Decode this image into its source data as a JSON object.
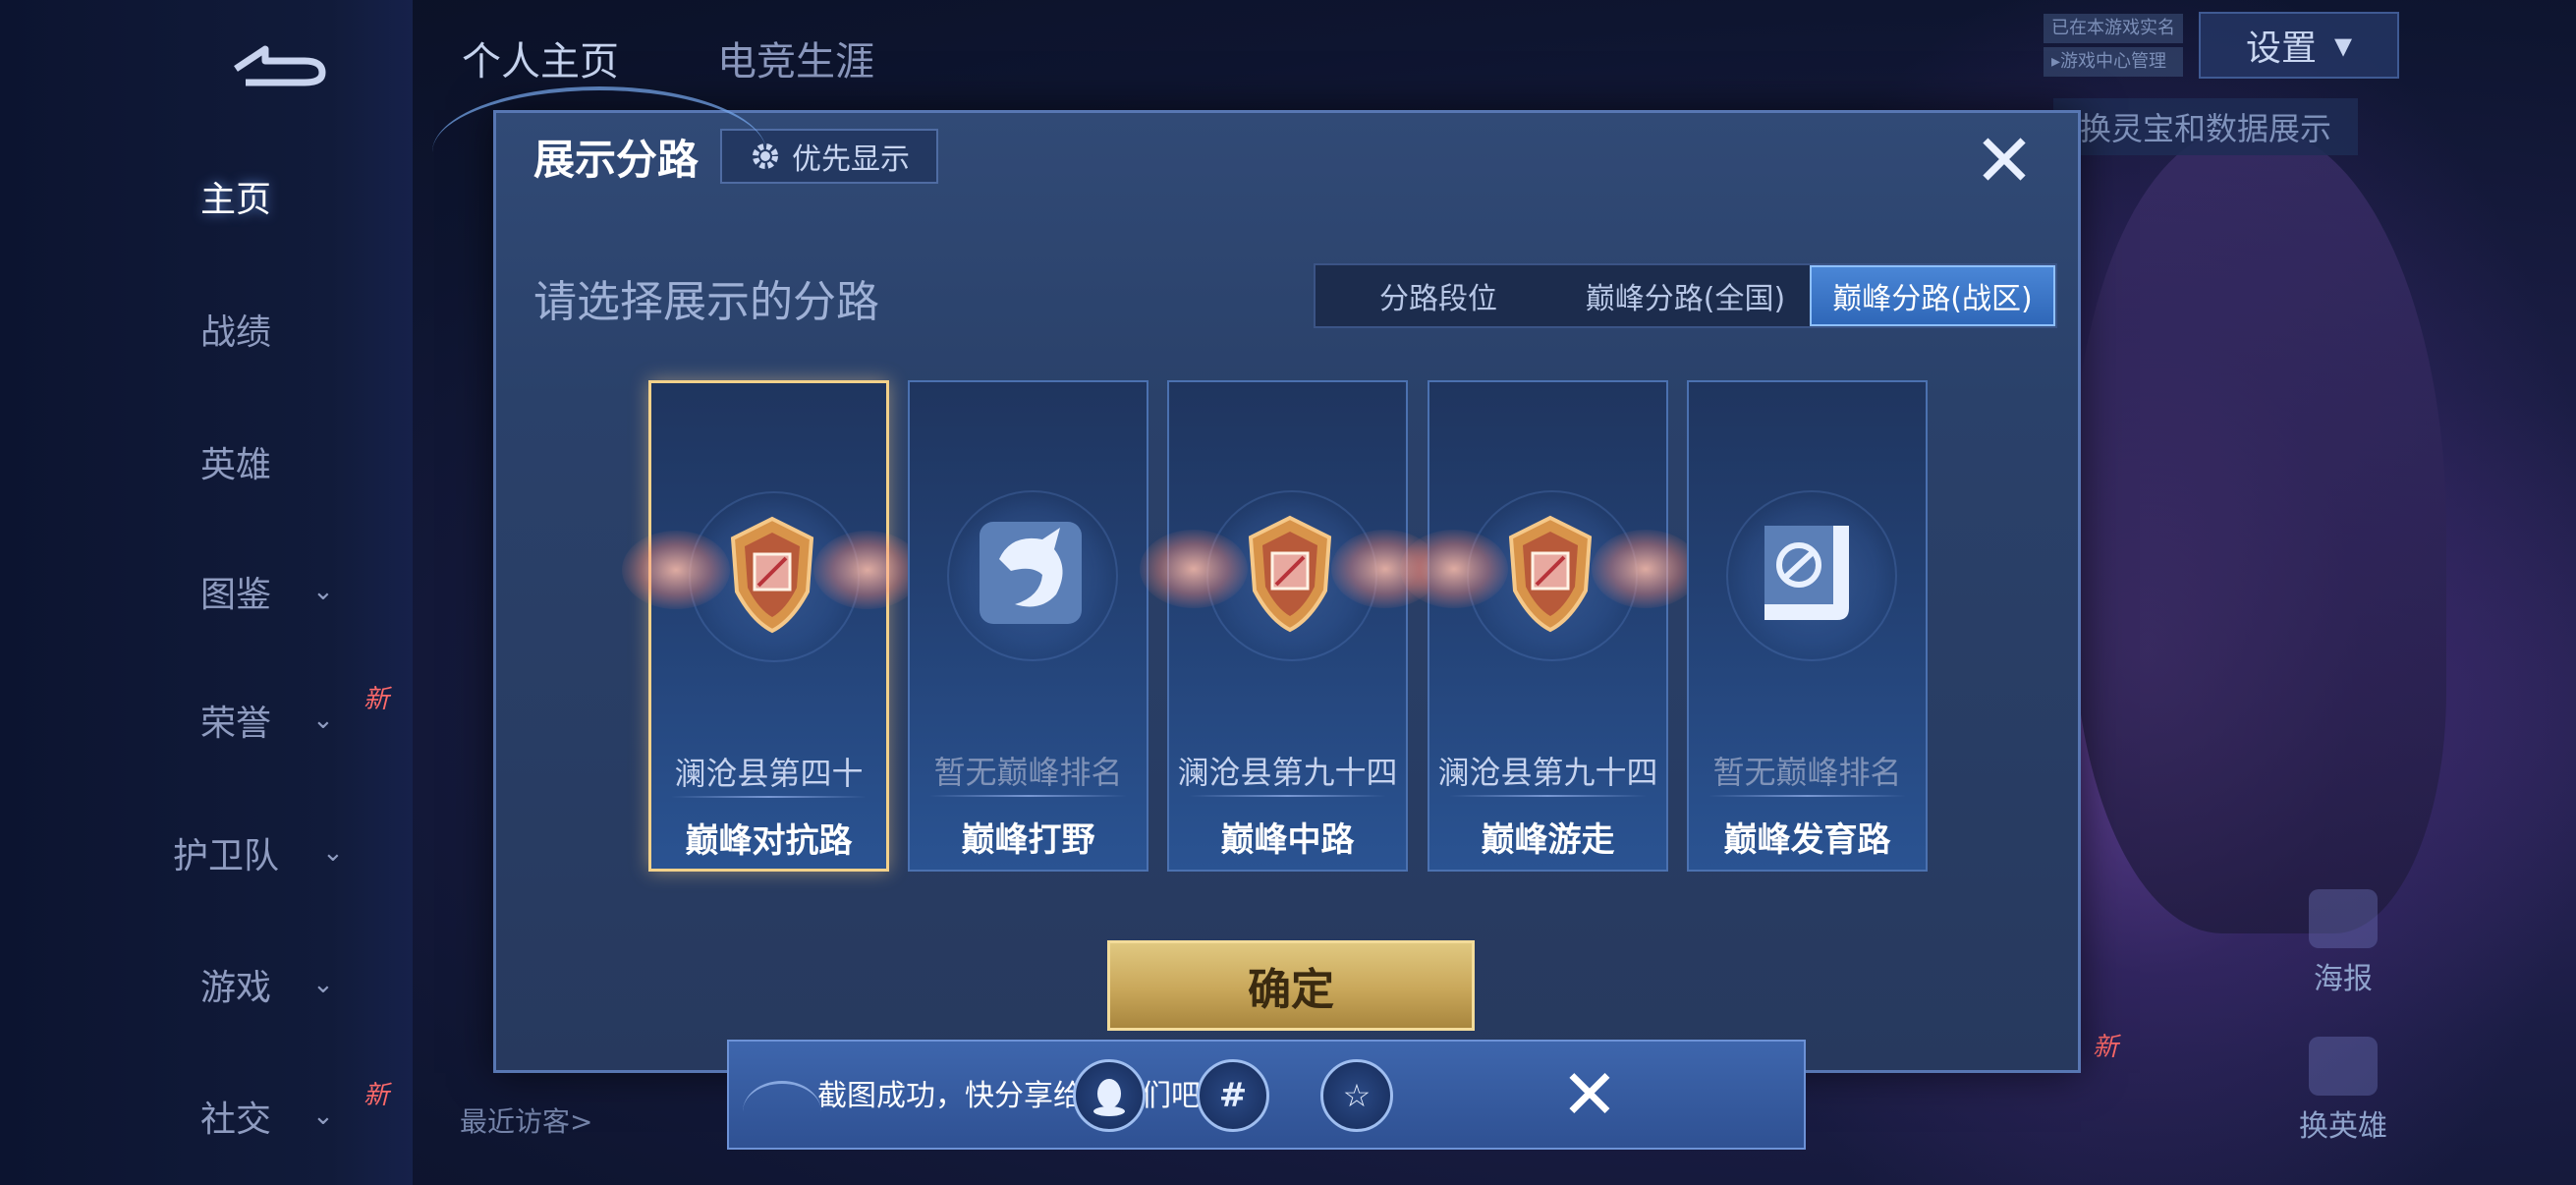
{
  "sidebar": {
    "items": [
      {
        "label": "主页",
        "active": true,
        "chevron": false,
        "new": false
      },
      {
        "label": "战绩",
        "active": false,
        "chevron": false,
        "new": false
      },
      {
        "label": "英雄",
        "active": false,
        "chevron": false,
        "new": false
      },
      {
        "label": "图鉴",
        "active": false,
        "chevron": true,
        "new": false
      },
      {
        "label": "荣誉",
        "active": false,
        "chevron": true,
        "new": true
      },
      {
        "label": "护卫队",
        "active": false,
        "chevron": true,
        "new": false
      },
      {
        "label": "游戏",
        "active": false,
        "chevron": true,
        "new": false
      },
      {
        "label": "社交",
        "active": false,
        "chevron": true,
        "new": true
      }
    ],
    "new_label": "新",
    "chevron_glyph": "⌄"
  },
  "top_tabs": [
    {
      "label": "个人主页",
      "active": true
    },
    {
      "label": "电竞生涯",
      "active": false
    }
  ],
  "header_right": {
    "settings_label": "设置",
    "realname_line1": "已在本游戏实名",
    "realname_line2": "▸游戏中心管理",
    "switch_tip": "换灵宝和数据展示",
    "poster_label": "海报",
    "switch_hero_label": "换英雄",
    "new_label": "新"
  },
  "visitor_label": "最近访客>",
  "modal": {
    "title": "展示分路",
    "priority_label": "优先显示",
    "close_glyph": "✕",
    "subtitle": "请选择展示的分路",
    "segments": [
      {
        "label": "分路段位",
        "active": false
      },
      {
        "label": "巅峰分路(全国)",
        "active": false
      },
      {
        "label": "巅峰分路(战区)",
        "active": true
      }
    ],
    "cards": [
      {
        "rank": "澜沧县第四十",
        "lane": "巅峰对抗路",
        "emblem": "winged-shield-emblem",
        "has_rank": true,
        "selected": true
      },
      {
        "rank": "暂无巅峰排名",
        "lane": "巅峰打野",
        "emblem": "jungle-dragon-emblem",
        "has_rank": false,
        "selected": false
      },
      {
        "rank": "澜沧县第九十四",
        "lane": "巅峰中路",
        "emblem": "winged-shield-emblem",
        "has_rank": true,
        "selected": false
      },
      {
        "rank": "澜沧县第九十四",
        "lane": "巅峰游走",
        "emblem": "winged-shield-emblem",
        "has_rank": true,
        "selected": false
      },
      {
        "rank": "暂无巅峰排名",
        "lane": "巅峰发育路",
        "emblem": "marksman-emblem",
        "has_rank": false,
        "selected": false
      }
    ],
    "confirm_label": "确定"
  },
  "toast": {
    "message": "截图成功，快分享给朋友们吧!",
    "share_targets": [
      "qq-share-icon",
      "wechat-moments-share-icon",
      "qzone-share-icon"
    ],
    "close_glyph": "✕"
  },
  "colors": {
    "accent_gold": "#f3d18a",
    "segment_active": "#3a78c8",
    "modal_bg": "#2c4370",
    "confirm_gold": "#c9a75a"
  }
}
